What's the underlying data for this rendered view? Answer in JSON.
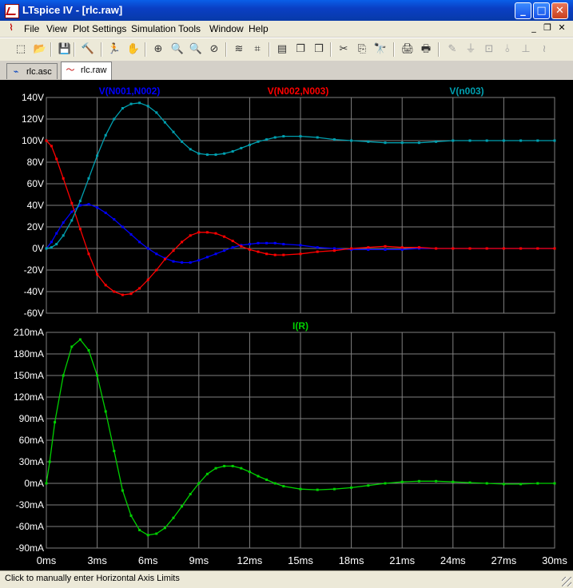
{
  "window": {
    "title": "LTspice IV - [rlc.raw]",
    "minimize": "_",
    "maximize": "□",
    "close": "✕"
  },
  "menu": {
    "items": [
      "File",
      "View",
      "Plot Settings",
      "Simulation",
      "Tools",
      "Window",
      "Help"
    ],
    "mdi": [
      "_",
      "❐",
      "✕"
    ]
  },
  "toolbar": {
    "icons": [
      "new-schematic-icon",
      "open-icon",
      "save-icon",
      "control-panel-icon",
      "run-icon",
      "halt-icon",
      "zoom-area-icon",
      "zoom-in-icon",
      "zoom-out-icon",
      "zoom-cancel-icon",
      "autorange-icon",
      "fft-icon",
      "tile-horizontal-icon",
      "cascade-icon",
      "tile-vertical-icon",
      "cut-icon",
      "copy-icon",
      "find-icon",
      "print-preview-icon",
      "print-icon",
      "wire-icon",
      "ground-icon",
      "label-icon",
      "resistor-icon",
      "capacitor-icon",
      "inductor-icon"
    ],
    "glyphs": [
      "⬚",
      "📂",
      "💾",
      "🔨",
      "🏃",
      "✋",
      "⊕",
      "🔍",
      "🔍",
      "⊘",
      "≋",
      "⌗",
      "▤",
      "❐",
      "❒",
      "✂",
      "⎘",
      "🔭",
      "🖨",
      "🖶",
      "✎",
      "⏚",
      "⊡",
      "⫰",
      "⊥",
      "≀"
    ]
  },
  "tabs": [
    {
      "label": "rlc.asc",
      "icon": "schematic-icon",
      "glyph": "⌁",
      "active": false
    },
    {
      "label": "rlc.raw",
      "icon": "waveform-icon",
      "glyph": "〜",
      "active": true
    }
  ],
  "status": {
    "text": "Click to manually enter Horizontal Axis Limits"
  },
  "colors": {
    "v_n001_n002": "#0000ff",
    "v_n002_n003": "#ff0000",
    "v_n003": "#00a0b0",
    "i_r": "#00d000",
    "grid": "#808080",
    "axis_text": "#ffffff"
  },
  "chart_data": [
    {
      "type": "line",
      "title": "",
      "xlabel": "",
      "ylabel": "",
      "xlim": [
        0,
        30
      ],
      "ylim": [
        -60,
        140
      ],
      "x_ticks": [
        "0ms",
        "3ms",
        "6ms",
        "9ms",
        "12ms",
        "15ms",
        "18ms",
        "21ms",
        "24ms",
        "27ms",
        "30ms"
      ],
      "y_ticks": [
        "-60V",
        "-40V",
        "-20V",
        "0V",
        "20V",
        "40V",
        "60V",
        "80V",
        "100V",
        "120V",
        "140V"
      ],
      "grid": true,
      "legend": "top",
      "series": [
        {
          "name": "V(N001,N002)",
          "color": "#0000ff",
          "x": [
            0,
            0.3,
            0.6,
            1,
            1.5,
            2,
            2.5,
            3,
            3.5,
            4,
            4.5,
            5,
            5.5,
            6,
            6.5,
            7,
            7.5,
            8,
            8.5,
            9,
            9.5,
            10,
            10.5,
            11,
            11.5,
            12,
            12.5,
            13,
            13.5,
            14,
            15,
            16,
            17,
            18,
            19,
            20,
            21,
            22,
            23,
            24,
            25,
            26,
            27,
            28,
            29,
            30
          ],
          "y": [
            0,
            6,
            14,
            24,
            34,
            40,
            41,
            38,
            33,
            27,
            20,
            13,
            6,
            0,
            -5,
            -9,
            -12,
            -13,
            -13,
            -11,
            -8,
            -5,
            -2,
            1,
            3,
            4,
            5,
            5,
            5,
            4,
            3,
            1,
            0,
            -1,
            -1,
            -1,
            -1,
            0,
            0,
            0,
            0,
            0,
            0,
            0,
            0,
            0
          ]
        },
        {
          "name": "V(N002,N003)",
          "color": "#ff0000",
          "x": [
            0,
            0.3,
            0.6,
            1,
            1.5,
            2,
            2.5,
            3,
            3.5,
            4,
            4.5,
            5,
            5.5,
            6,
            6.5,
            7,
            7.5,
            8,
            8.5,
            9,
            9.5,
            10,
            10.5,
            11,
            11.5,
            12,
            12.5,
            13,
            13.5,
            14,
            15,
            16,
            17,
            18,
            19,
            20,
            21,
            22,
            23,
            24,
            25,
            26,
            27,
            28,
            29,
            30
          ],
          "y": [
            100,
            95,
            83,
            65,
            42,
            18,
            -5,
            -24,
            -34,
            -40,
            -43,
            -42,
            -37,
            -29,
            -20,
            -10,
            -2,
            6,
            12,
            15,
            15,
            14,
            11,
            7,
            2,
            -1,
            -3,
            -5,
            -6,
            -6,
            -5,
            -3,
            -2,
            0,
            1,
            2,
            1,
            1,
            0,
            0,
            0,
            0,
            0,
            0,
            0,
            0
          ]
        },
        {
          "name": "V(n003)",
          "color": "#00a0b0",
          "x": [
            0,
            0.3,
            0.6,
            1,
            1.5,
            2,
            2.5,
            3,
            3.5,
            4,
            4.5,
            5,
            5.5,
            6,
            6.5,
            7,
            7.5,
            8,
            8.5,
            9,
            9.5,
            10,
            10.5,
            11,
            11.5,
            12,
            12.5,
            13,
            13.5,
            14,
            15,
            16,
            17,
            18,
            19,
            20,
            21,
            22,
            23,
            24,
            25,
            26,
            27,
            28,
            29,
            30
          ],
          "y": [
            0,
            1,
            4,
            12,
            26,
            44,
            65,
            86,
            105,
            120,
            130,
            134,
            135,
            132,
            126,
            117,
            108,
            99,
            92,
            88,
            87,
            87,
            88,
            90,
            93,
            96,
            99,
            101,
            103,
            104,
            104,
            103,
            101,
            100,
            99,
            98,
            98,
            98,
            99,
            100,
            100,
            100,
            100,
            100,
            100,
            100
          ]
        }
      ]
    },
    {
      "type": "line",
      "title": "",
      "xlabel": "",
      "ylabel": "",
      "xlim": [
        0,
        30
      ],
      "ylim": [
        -90,
        210
      ],
      "x_ticks": [
        "0ms",
        "3ms",
        "6ms",
        "9ms",
        "12ms",
        "15ms",
        "18ms",
        "21ms",
        "24ms",
        "27ms",
        "30ms"
      ],
      "y_ticks": [
        "-90mA",
        "-60mA",
        "-30mA",
        "0mA",
        "30mA",
        "60mA",
        "90mA",
        "120mA",
        "150mA",
        "180mA",
        "210mA"
      ],
      "grid": true,
      "legend": "top",
      "series": [
        {
          "name": "I(R)",
          "color": "#00d000",
          "x": [
            0,
            0.2,
            0.5,
            1,
            1.5,
            2,
            2.5,
            3,
            3.5,
            4,
            4.5,
            5,
            5.5,
            6,
            6.5,
            7,
            7.5,
            8,
            8.5,
            9,
            9.5,
            10,
            10.5,
            11,
            11.5,
            12,
            12.5,
            13,
            13.5,
            14,
            15,
            16,
            17,
            18,
            19,
            20,
            21,
            22,
            23,
            24,
            25,
            26,
            27,
            28,
            29,
            30
          ],
          "y": [
            0,
            30,
            85,
            150,
            190,
            200,
            185,
            150,
            100,
            45,
            -10,
            -45,
            -65,
            -72,
            -70,
            -62,
            -48,
            -32,
            -15,
            0,
            13,
            21,
            24,
            24,
            21,
            16,
            10,
            5,
            0,
            -4,
            -8,
            -9,
            -8,
            -6,
            -3,
            0,
            2,
            3,
            3,
            2,
            1,
            0,
            -1,
            -1,
            0,
            0
          ]
        }
      ]
    }
  ]
}
